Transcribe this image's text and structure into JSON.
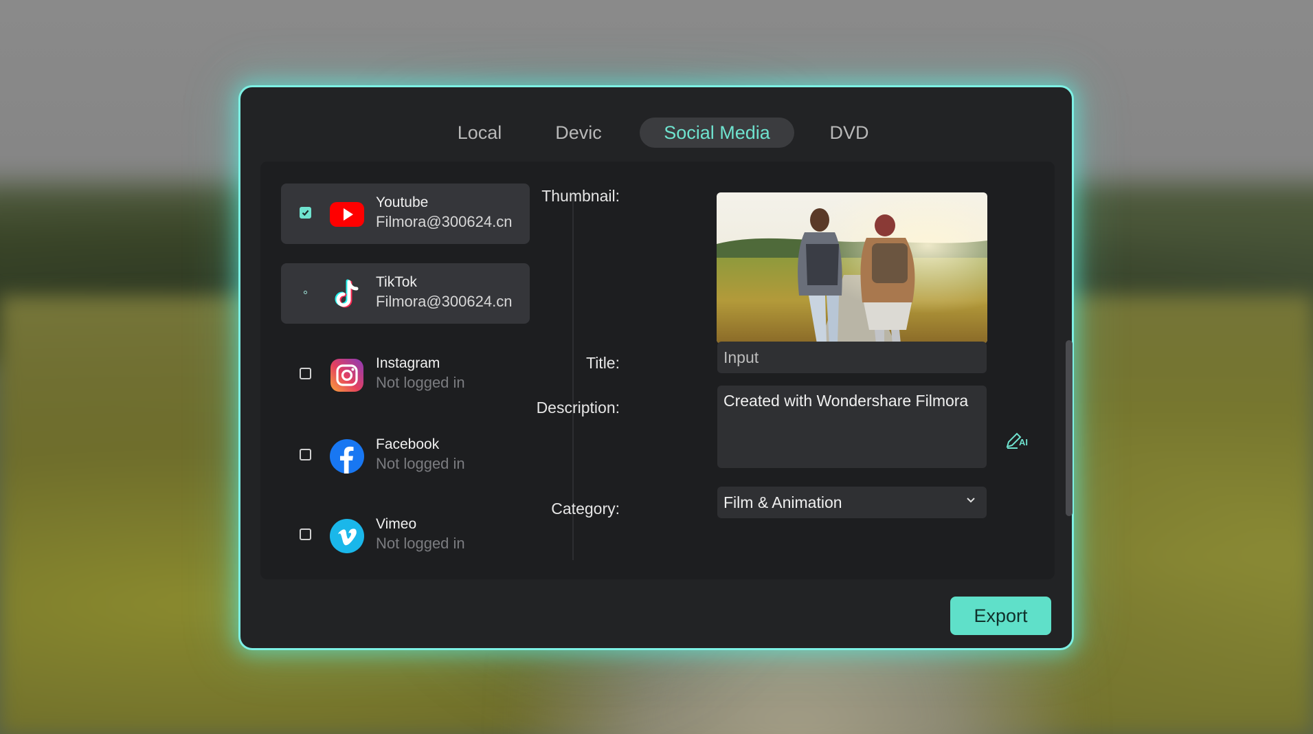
{
  "tabs": [
    {
      "label": "Local"
    },
    {
      "label": "Devic"
    },
    {
      "label": "Social Media"
    },
    {
      "label": "DVD"
    }
  ],
  "active_tab": "Social Media",
  "platforms": [
    {
      "name": "Youtube",
      "status": "Filmora@300624.cn",
      "checked": true,
      "icon": "youtube-icon"
    },
    {
      "name": "TikTok",
      "status": "Filmora@300624.cn",
      "checked": false,
      "icon": "tiktok-icon"
    },
    {
      "name": "Instagram",
      "status": "Not logged in",
      "checked": false,
      "icon": "instagram-icon"
    },
    {
      "name": "Facebook",
      "status": "Not logged in",
      "checked": false,
      "icon": "facebook-icon"
    },
    {
      "name": "Vimeo",
      "status": "Not logged in",
      "checked": false,
      "icon": "vimeo-icon"
    }
  ],
  "form": {
    "thumbnail_label": "Thumbnail:",
    "title_label": "Title:",
    "title_placeholder": "Input",
    "description_label": "Description:",
    "description_value": "Created with Wondershare Filmora",
    "category_label": "Category:",
    "category_value": "Film & Animation",
    "ai_badge": "AI"
  },
  "export_label": "Export",
  "colors": {
    "accent": "#6fe3cf",
    "glow_border": "#7ef0e4",
    "dialog_bg": "#222325",
    "export_bg": "#5fe0c9"
  }
}
